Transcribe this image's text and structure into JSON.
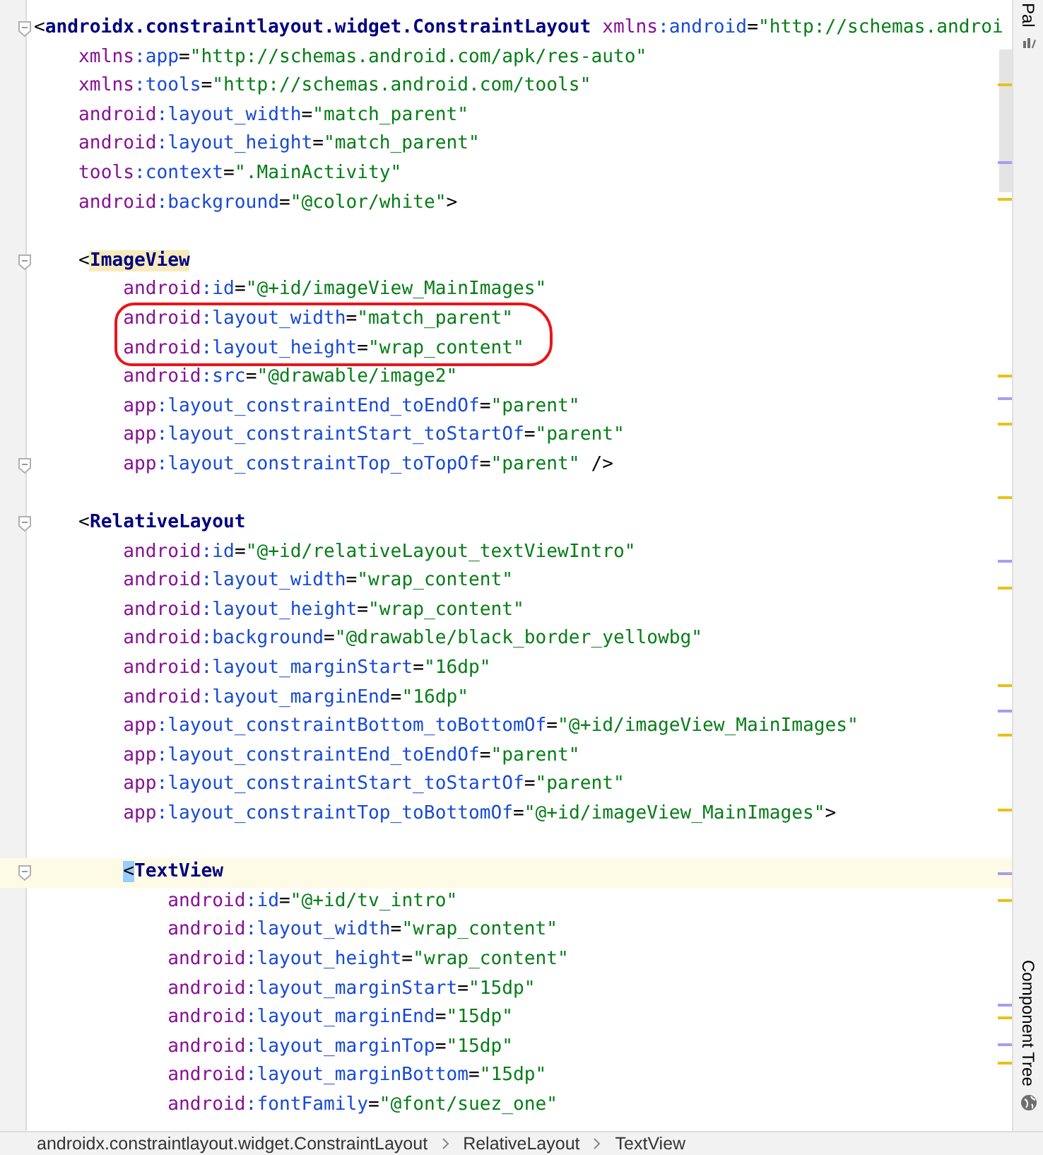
{
  "blocks": [
    {
      "lines": [
        {
          "text": "<androidx.constraintlayout.widget.ConstraintLayout xmlns:android=\"http://schemas.androi",
          "fold": true,
          "current": false,
          "circled": false,
          "highlighted": false
        },
        {
          "text": "    xmlns:app=\"http://schemas.android.com/apk/res-auto\"",
          "fold": false,
          "current": false,
          "circled": false,
          "highlighted": false
        },
        {
          "text": "    xmlns:tools=\"http://schemas.android.com/tools\"",
          "fold": false,
          "current": false,
          "circled": false,
          "highlighted": false
        },
        {
          "text": "    android:layout_width=\"match_parent\"",
          "fold": false,
          "current": false,
          "circled": false,
          "highlighted": false
        },
        {
          "text": "    android:layout_height=\"match_parent\"",
          "fold": false,
          "current": false,
          "circled": false,
          "highlighted": false
        },
        {
          "text": "    tools:context=\".MainActivity\"",
          "fold": false,
          "current": false,
          "circled": false,
          "highlighted": false
        },
        {
          "text": "    android:background=\"@color/white\">",
          "fold": false,
          "current": false,
          "circled": false,
          "highlighted": false
        }
      ]
    },
    {
      "lines": [
        {
          "text": "    <ImageView",
          "fold": true,
          "current": false,
          "circled": false,
          "highlighted": true
        },
        {
          "text": "        android:id=\"@+id/imageView_MainImages\"",
          "fold": false,
          "current": false,
          "circled": false,
          "highlighted": false
        },
        {
          "text": "        android:layout_width=\"match_parent\"",
          "fold": false,
          "current": false,
          "circled": true,
          "highlighted": false
        },
        {
          "text": "        android:layout_height=\"wrap_content\"",
          "fold": false,
          "current": false,
          "circled": true,
          "highlighted": false
        },
        {
          "text": "        android:src=\"@drawable/image2\"",
          "fold": false,
          "current": false,
          "circled": false,
          "highlighted": false
        },
        {
          "text": "        app:layout_constraintEnd_toEndOf=\"parent\"",
          "fold": false,
          "current": false,
          "circled": false,
          "highlighted": false
        },
        {
          "text": "        app:layout_constraintStart_toStartOf=\"parent\"",
          "fold": false,
          "current": false,
          "circled": false,
          "highlighted": false
        },
        {
          "text": "        app:layout_constraintTop_toTopOf=\"parent\" />",
          "fold": true,
          "current": false,
          "circled": false,
          "highlighted": false
        }
      ]
    },
    {
      "lines": [
        {
          "text": "    <RelativeLayout",
          "fold": true,
          "current": false,
          "circled": false,
          "highlighted": false
        },
        {
          "text": "        android:id=\"@+id/relativeLayout_textViewIntro\"",
          "fold": false,
          "current": false,
          "circled": false,
          "highlighted": false
        },
        {
          "text": "        android:layout_width=\"wrap_content\"",
          "fold": false,
          "current": false,
          "circled": false,
          "highlighted": false
        },
        {
          "text": "        android:layout_height=\"wrap_content\"",
          "fold": false,
          "current": false,
          "circled": false,
          "highlighted": false
        },
        {
          "text": "        android:background=\"@drawable/black_border_yellowbg\"",
          "fold": false,
          "current": false,
          "circled": false,
          "highlighted": false
        },
        {
          "text": "        android:layout_marginStart=\"16dp\"",
          "fold": false,
          "current": false,
          "circled": false,
          "highlighted": false
        },
        {
          "text": "        android:layout_marginEnd=\"16dp\"",
          "fold": false,
          "current": false,
          "circled": false,
          "highlighted": false
        },
        {
          "text": "        app:layout_constraintBottom_toBottomOf=\"@+id/imageView_MainImages\"",
          "fold": false,
          "current": false,
          "circled": false,
          "highlighted": false
        },
        {
          "text": "        app:layout_constraintEnd_toEndOf=\"parent\"",
          "fold": false,
          "current": false,
          "circled": false,
          "highlighted": false
        },
        {
          "text": "        app:layout_constraintStart_toStartOf=\"parent\"",
          "fold": false,
          "current": false,
          "circled": false,
          "highlighted": false
        },
        {
          "text": "        app:layout_constraintTop_toBottomOf=\"@+id/imageView_MainImages\">",
          "fold": false,
          "current": false,
          "circled": false,
          "highlighted": false
        }
      ]
    },
    {
      "lines": [
        {
          "text": "        <TextView",
          "fold": true,
          "current": true,
          "circled": false,
          "highlighted": false
        },
        {
          "text": "            android:id=\"@+id/tv_intro\"",
          "fold": false,
          "current": false,
          "circled": false,
          "highlighted": false
        },
        {
          "text": "            android:layout_width=\"wrap_content\"",
          "fold": false,
          "current": false,
          "circled": false,
          "highlighted": false
        },
        {
          "text": "            android:layout_height=\"wrap_content\"",
          "fold": false,
          "current": false,
          "circled": false,
          "highlighted": false
        },
        {
          "text": "            android:layout_marginStart=\"15dp\"",
          "fold": false,
          "current": false,
          "circled": false,
          "highlighted": false
        },
        {
          "text": "            android:layout_marginEnd=\"15dp\"",
          "fold": false,
          "current": false,
          "circled": false,
          "highlighted": false
        },
        {
          "text": "            android:layout_marginTop=\"15dp\"",
          "fold": false,
          "current": false,
          "circled": false,
          "highlighted": false
        },
        {
          "text": "            android:layout_marginBottom=\"15dp\"",
          "fold": false,
          "current": false,
          "circled": false,
          "highlighted": false
        },
        {
          "text": "            android:fontFamily=\"@font/suez_one\"",
          "fold": false,
          "current": false,
          "circled": false,
          "highlighted": false
        }
      ]
    }
  ],
  "side_tabs": [
    {
      "label": "Pal",
      "kind": "palette"
    },
    {
      "label": "Component Tree",
      "kind": "tree"
    }
  ],
  "breadcrumb": [
    "androidx.constraintlayout.widget.ConstraintLayout",
    "RelativeLayout",
    "TextView"
  ]
}
